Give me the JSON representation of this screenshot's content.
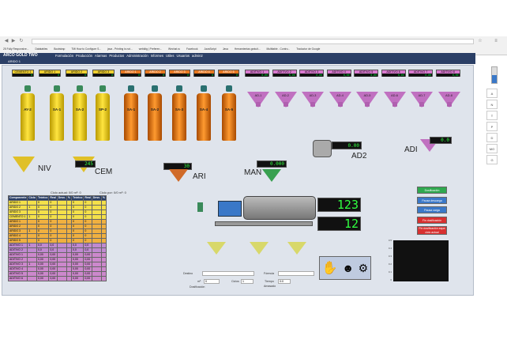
{
  "browser": {
    "address": "",
    "bookmarks": [
      "25 Fully Responsive...",
      "Datatables",
      "Bootstrap",
      "TMi How to Configure S...",
      "java - Printing is not...",
      "webkitg | Preferen...",
      "Wechat.ru",
      "Facebook",
      "JavaScript",
      "Java",
      "Herramientas gratuit...",
      "Multitable - Contro...",
      "Traductor de Google"
    ]
  },
  "app": {
    "brand": "ARCO GOLD TWO",
    "sub": "ARIDO 1",
    "menu": [
      "Formulación",
      "Producción",
      "Alarmas",
      "Productos",
      "Administración",
      "Informes",
      "Utiles",
      "Usuarios",
      "admin2"
    ]
  },
  "tags": {
    "yellow": [
      {
        "label": "CEMENTO 1",
        "value": "0"
      },
      {
        "label": "ARIDO 1",
        "value": "0"
      },
      {
        "label": "ARIDO 2",
        "value": "0"
      },
      {
        "label": "ARIDO 3",
        "value": "0"
      }
    ],
    "orange": [
      {
        "label": "ARIDO 1",
        "value": "0"
      },
      {
        "label": "ARIDO 2",
        "value": "0"
      },
      {
        "label": "ARIDO 3",
        "value": "0"
      },
      {
        "label": "ARIDO 4",
        "value": "0"
      },
      {
        "label": "ARIDO 5",
        "value": "0"
      }
    ],
    "pink": [
      {
        "label": "ADITIVO 1",
        "value": "0,00"
      },
      {
        "label": "ADITIVO 2",
        "value": "0,00"
      },
      {
        "label": "ADITIVO 3",
        "value": "0,00"
      },
      {
        "label": "ADITIVO 4",
        "value": "0,00"
      },
      {
        "label": "ADITIVO 5",
        "value": "0,00"
      },
      {
        "label": "ADITIVO 6",
        "value": "0,00"
      },
      {
        "label": "ADITIVO 7",
        "value": "0,00"
      },
      {
        "label": "ADITIVO 8",
        "value": "0,00"
      }
    ]
  },
  "silos": {
    "yellow": [
      "AY-2",
      "SA-1",
      "SA-2",
      "SP-2"
    ],
    "orange": [
      "SA-1",
      "SA-2",
      "SA-3",
      "SA-4",
      "SA-5"
    ],
    "hoppers": [
      "AD-1",
      "AD-2",
      "AD-3",
      "AD-4",
      "AD-5",
      "AD-6",
      "AD-7",
      "AD-8"
    ]
  },
  "gauges": {
    "cem": "245",
    "ari": "30",
    "man": "0.000",
    "ad2": "0.00",
    "adi": "0.0"
  },
  "labels": {
    "niv": "NIV",
    "cem": "CEM",
    "ari": "ARI",
    "man": "MAN",
    "ad2": "AD2",
    "adi": "ADI"
  },
  "counters": {
    "top": "123",
    "bottom": "12"
  },
  "buttons": [
    {
      "label": "Dosificación",
      "color": "#2fa84f"
    },
    {
      "label": "Pausa descarga",
      "color": "#3a78c8"
    },
    {
      "label": "Pausa carga",
      "color": "#3a78c8"
    },
    {
      "label": "Fin dosificación",
      "color": "#d83030"
    },
    {
      "label": "Fin dosificación aqua ciclo actual",
      "color": "#d83030"
    }
  ],
  "cycle_info": {
    "left": "Ciclo actual: 0/0  m³: 0",
    "right": "Ciclo por: 0/0  m³: 0"
  },
  "table": {
    "headers": [
      "Componente",
      "Ciclo",
      "Teórico",
      "Real",
      "Desv.",
      "%",
      "Teórico",
      "Real",
      "Desv.",
      "%"
    ],
    "rows": [
      {
        "style": "ry",
        "cells": [
          "ARIDO 1",
          "",
          "0",
          "0",
          "",
          "",
          "0",
          "0",
          "",
          ""
        ]
      },
      {
        "style": "ry",
        "cells": [
          "ARIDO 2",
          "1",
          "0",
          "0",
          "",
          "",
          "0",
          "0",
          "",
          ""
        ]
      },
      {
        "style": "ry",
        "cells": [
          "ARIDO 3",
          "",
          "0",
          "0",
          "",
          "",
          "0",
          "0",
          "",
          ""
        ]
      },
      {
        "style": "ry",
        "cells": [
          "CEMENTO 1",
          "1",
          "0",
          "0",
          "",
          "",
          "0",
          "0",
          "",
          ""
        ]
      },
      {
        "style": "ro",
        "cells": [
          "ARIDO 1",
          "",
          "0",
          "0",
          "",
          "",
          "0",
          "0",
          "",
          ""
        ]
      },
      {
        "style": "ro",
        "cells": [
          "ARIDO 2",
          "",
          "0",
          "0",
          "",
          "",
          "0",
          "0",
          "",
          ""
        ]
      },
      {
        "style": "ro",
        "cells": [
          "ARIDO 3",
          "1",
          "0",
          "0",
          "",
          "",
          "0",
          "0",
          "",
          ""
        ]
      },
      {
        "style": "ro",
        "cells": [
          "ARIDO 4",
          "",
          "0",
          "0",
          "",
          "",
          "0",
          "0",
          "",
          ""
        ]
      },
      {
        "style": "ro",
        "cells": [
          "ARIDO 5",
          "",
          "0",
          "0",
          "",
          "",
          "0",
          "0",
          "",
          ""
        ]
      },
      {
        "style": "rp",
        "cells": [
          "ADITIVO 1",
          "1",
          "0,0",
          "0,0",
          "",
          "",
          "0,0",
          "0,0",
          "",
          ""
        ]
      },
      {
        "style": "rp",
        "cells": [
          "ADITIVO 2",
          "",
          "0,0",
          "0,0",
          "",
          "",
          "0,0",
          "0,0",
          "",
          ""
        ]
      },
      {
        "style": "rv",
        "cells": [
          "ADITIVO 1",
          "",
          "0,00",
          "0,00",
          "",
          "",
          "0,00",
          "0,00",
          "",
          ""
        ]
      },
      {
        "style": "rv",
        "cells": [
          "ADITIVO 2",
          "",
          "0,00",
          "0,00",
          "",
          "",
          "0,00",
          "0,00",
          "",
          ""
        ]
      },
      {
        "style": "rv",
        "cells": [
          "ADITIVO 3",
          "1",
          "0,00",
          "0,00",
          "",
          "",
          "0,00",
          "0,00",
          "",
          ""
        ]
      },
      {
        "style": "rv",
        "cells": [
          "ADITIVO 4",
          "",
          "0,00",
          "0,00",
          "",
          "",
          "0,00",
          "0,00",
          "",
          ""
        ]
      },
      {
        "style": "rv",
        "cells": [
          "ADITIVO 5",
          "",
          "0,00",
          "0,00",
          "",
          "",
          "0,00",
          "0,00",
          "",
          ""
        ]
      },
      {
        "style": "rv",
        "cells": [
          "ADITIVO 6",
          "",
          "0,00",
          "0,00",
          "",
          "",
          "0,00",
          "0,00",
          "",
          ""
        ]
      }
    ]
  },
  "form": {
    "destino_label": "Destino",
    "formula_label": "Fórmula",
    "m3_label": "m³",
    "m3_value": "0",
    "ciclos_label": "Ciclos",
    "ciclos_value": "1",
    "tiempo_label": "Tiempo",
    "tiempo_value": "0:0",
    "amasado_label": "Amasado",
    "dosificacion_label": "Dosificación"
  },
  "sidebar": {
    "items": [
      "A",
      "N",
      "T",
      "P",
      "D",
      "MO",
      "G"
    ]
  },
  "chart_ticks": [
    "0.5",
    "0.4",
    "0.3",
    "0.2",
    "0.1",
    "0"
  ]
}
